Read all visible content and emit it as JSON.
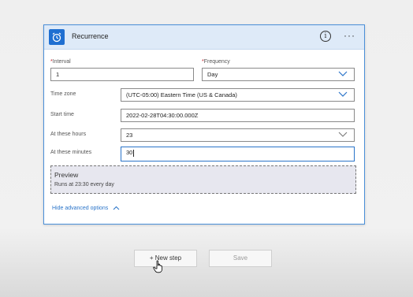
{
  "card": {
    "title": "Recurrence",
    "info_glyph": "i",
    "more_glyph": "···",
    "icon": "alarm-clock-icon",
    "accent": "#1f6fd1"
  },
  "form": {
    "interval": {
      "required": "*",
      "label": "Interval",
      "value": "1"
    },
    "frequency": {
      "required": "*",
      "label": "Frequency",
      "value": "Day"
    },
    "time_zone": {
      "label": "Time zone",
      "value": "(UTC-05:00) Eastern Time (US & Canada)"
    },
    "start_time": {
      "label": "Start time",
      "value": "2022-02-28T04:30:00.000Z"
    },
    "hours": {
      "label": "At these hours",
      "value": "23"
    },
    "minutes": {
      "label": "At these minutes",
      "value": "30"
    }
  },
  "preview": {
    "title": "Preview",
    "text": "Runs at 23:30 every day"
  },
  "advanced_link": "Hide advanced options",
  "buttons": {
    "new_step": "+ New step",
    "save": "Save"
  }
}
